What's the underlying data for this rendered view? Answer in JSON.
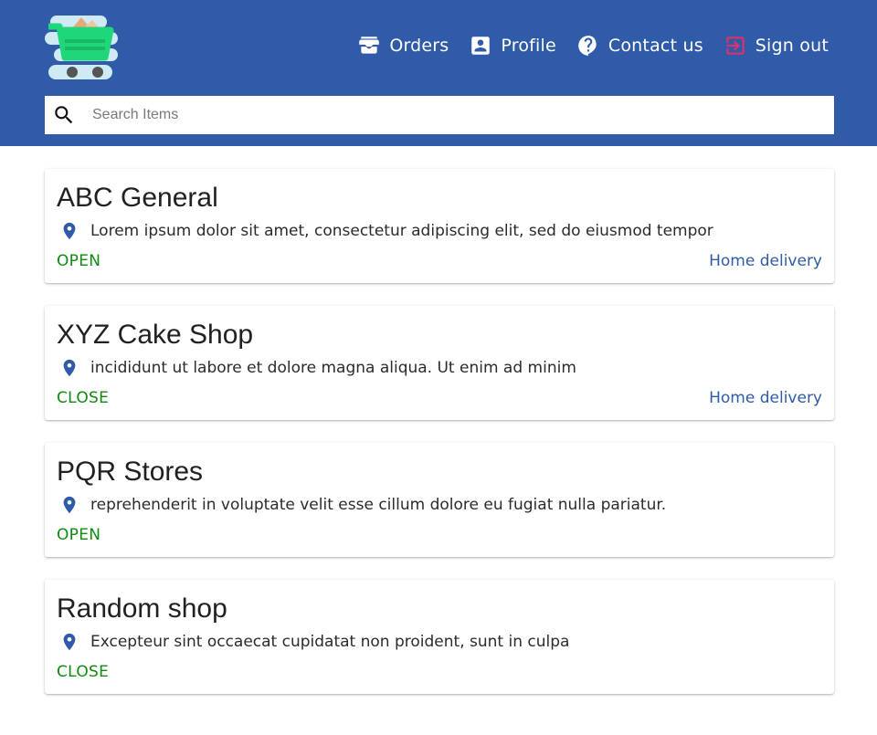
{
  "header": {
    "logo_icon": "shopping-cart-icon",
    "nav": [
      {
        "label": "Orders",
        "icon": "inbox-icon"
      },
      {
        "label": "Profile",
        "icon": "account-box-icon"
      },
      {
        "label": "Contact us",
        "icon": "help-icon"
      },
      {
        "label": "Sign out",
        "icon": "sign-out-icon"
      }
    ]
  },
  "search": {
    "placeholder": "Search Items",
    "value": ""
  },
  "shops": [
    {
      "name": "ABC General",
      "address": "Lorem ipsum dolor sit amet, consectetur adipiscing elit, sed do eiusmod tempor",
      "status": "OPEN",
      "delivery": "Home delivery"
    },
    {
      "name": "XYZ Cake Shop",
      "address": "incididunt ut labore et dolore magna aliqua. Ut enim ad minim",
      "status": "CLOSE",
      "delivery": "Home delivery"
    },
    {
      "name": "PQR Stores",
      "address": "reprehenderit in voluptate velit esse cillum dolore eu fugiat nulla pariatur.",
      "status": "OPEN",
      "delivery": ""
    },
    {
      "name": "Random shop",
      "address": "Excepteur sint occaecat cupidatat non proident, sunt in culpa",
      "status": "CLOSE",
      "delivery": ""
    }
  ],
  "colors": {
    "header_bg": "#2f5ba8",
    "status_green": "#108a10",
    "link_blue": "#2f5ba8",
    "sign_out_icon": "#e0306b",
    "cart_green": "#1fd67a"
  }
}
